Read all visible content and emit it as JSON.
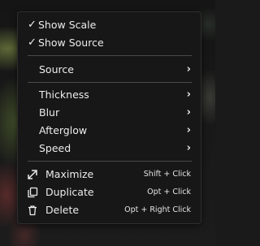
{
  "menu": {
    "toggles": [
      {
        "label": "Show Scale",
        "checked": true,
        "check_glyph": "✓"
      },
      {
        "label": "Show Source",
        "checked": true,
        "check_glyph": "✓"
      }
    ],
    "source": {
      "label": "Source",
      "chevron": "›"
    },
    "submenus": [
      {
        "label": "Thickness",
        "chevron": "›"
      },
      {
        "label": "Blur",
        "chevron": "›"
      },
      {
        "label": "Afterglow",
        "chevron": "›"
      },
      {
        "label": "Speed",
        "chevron": "›"
      }
    ],
    "actions": [
      {
        "label": "Maximize",
        "shortcut": "Shift + Click",
        "icon": "maximize-arrow-icon"
      },
      {
        "label": "Duplicate",
        "shortcut": "Opt + Click",
        "icon": "duplicate-icon"
      },
      {
        "label": "Delete",
        "shortcut": "Opt + Right Click",
        "icon": "trash-icon"
      }
    ]
  },
  "colors": {
    "menu_bg": "#171717",
    "text": "#ececec",
    "separator": "#4a4a4a"
  }
}
